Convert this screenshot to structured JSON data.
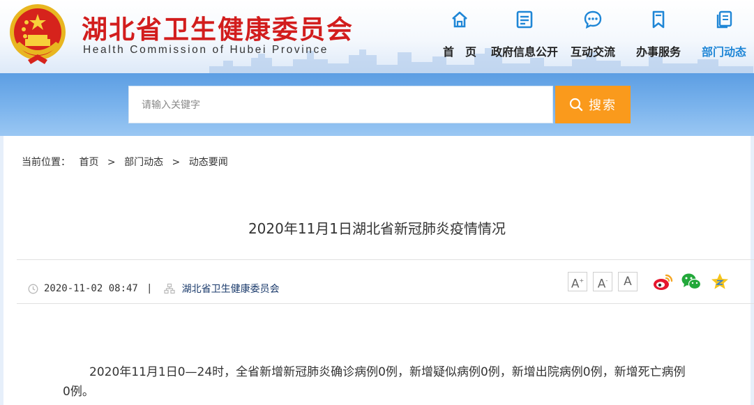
{
  "header": {
    "title": "湖北省卫生健康委员会",
    "subtitle": "Health Commission of Hubei Province"
  },
  "nav": [
    {
      "label": "首　页",
      "icon": "home-icon"
    },
    {
      "label": "政府信息公开",
      "icon": "document-icon"
    },
    {
      "label": "互动交流",
      "icon": "chat-bubble-icon"
    },
    {
      "label": "办事服务",
      "icon": "bookmark-icon"
    },
    {
      "label": "部门动态",
      "icon": "pages-icon",
      "active": true
    }
  ],
  "search": {
    "placeholder": "请输入关键字",
    "button_label": "搜索"
  },
  "breadcrumb": {
    "prefix": "当前位置：",
    "items": [
      "首页",
      "部门动态",
      "动态要闻"
    ],
    "separator": ">"
  },
  "article": {
    "title": "2020年11月1日湖北省新冠肺炎疫情情况",
    "date": "2020-11-02 08:47",
    "pipe": "|",
    "source": "湖北省卫生健康委员会",
    "body": "2020年11月1日0—24时，全省新增新冠肺炎确诊病例0例，新增疑似病例0例，新增出院病例0例，新增死亡病例0例。"
  },
  "font_controls": [
    "A",
    "A",
    "A"
  ],
  "share": [
    "weibo-icon",
    "wechat-icon",
    "favorite-star-icon"
  ],
  "colors": {
    "brand_red": "#d21d1d",
    "accent_blue": "#1f86d6",
    "search_orange": "#fa9a1c"
  }
}
